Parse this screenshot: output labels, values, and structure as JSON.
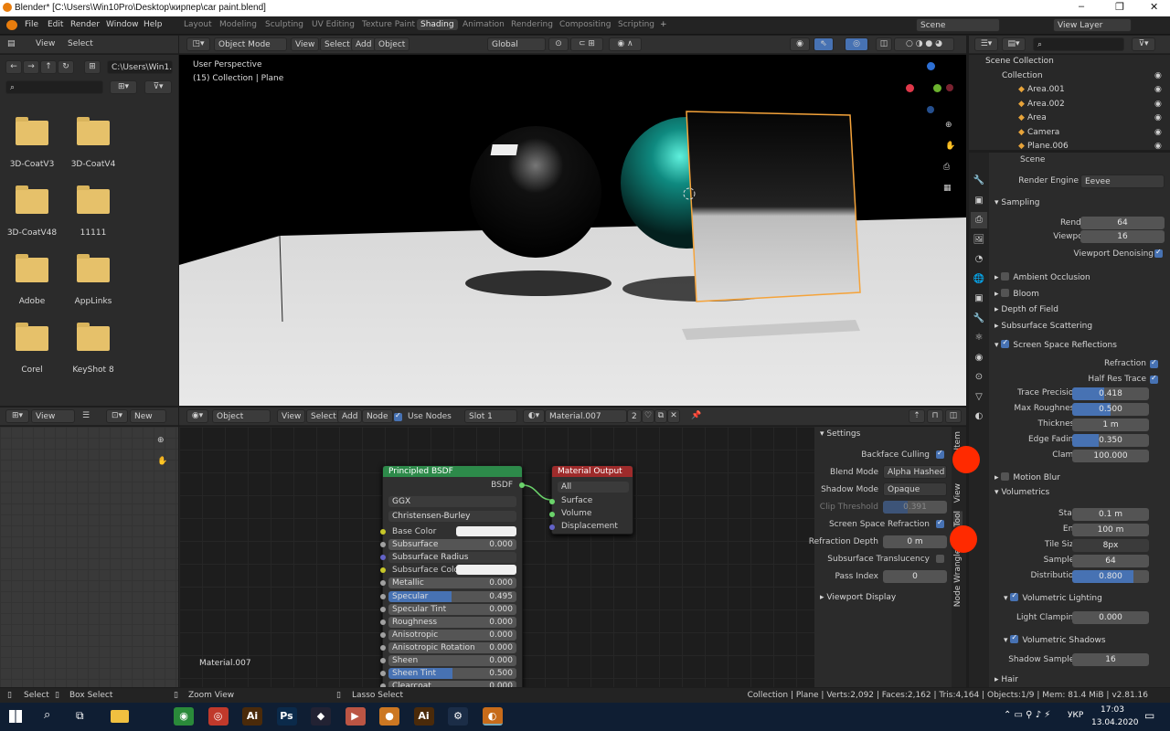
{
  "window": {
    "title": "Blender* [C:\\Users\\Win10Pro\\Desktop\\кирпер\\car paint.blend]",
    "controls": [
      "–",
      "❐",
      "✕"
    ]
  },
  "menu": [
    "File",
    "Edit",
    "Render",
    "Window",
    "Help"
  ],
  "workspaces": [
    "Layout",
    "Modeling",
    "Sculpting",
    "UV Editing",
    "Texture Paint",
    "Shading",
    "Animation",
    "Rendering",
    "Compositing",
    "Scripting"
  ],
  "scene": "Scene",
  "view_layer": "View Layer",
  "filebrowser": {
    "menus": [
      "View",
      "Select"
    ],
    "path": "C:\\Users\\Win1...",
    "folders": [
      "3D-CoatV3",
      "3D-CoatV4",
      "3D-CoatV48",
      "11111",
      "Adobe",
      "AppLinks",
      "Corel",
      "KeyShot 8"
    ]
  },
  "viewport": {
    "mode": "Object Mode",
    "menus": [
      "View",
      "Select",
      "Add",
      "Object"
    ],
    "orient": "Global",
    "persp": "User Perspective",
    "collection": "(15) Collection | Plane"
  },
  "outliner": {
    "items": [
      "Scene Collection",
      "Collection",
      "Area.001",
      "Area.002",
      "Area",
      "Camera",
      "Plane.006"
    ]
  },
  "props": {
    "scene_label": "Scene",
    "engine_label": "Render Engine",
    "engine": "Eevee",
    "sampling": "Sampling",
    "render_label": "Render",
    "render": "64",
    "viewport_label": "Viewport",
    "viewport": "16",
    "denoise": "Viewport Denoising",
    "sections": [
      "Ambient Occlusion",
      "Bloom",
      "Depth of Field",
      "Subsurface Scattering",
      "Screen Space Reflections"
    ],
    "ssr": [
      {
        "l": "Refraction"
      },
      {
        "l": "Half Res Trace"
      }
    ],
    "ssr_fields": [
      {
        "l": "Trace Precision",
        "v": "0.418",
        "f": 0.418
      },
      {
        "l": "Max Roughness",
        "v": "0.500",
        "f": 0.5
      },
      {
        "l": "Thickness",
        "v": "1 m",
        "f": 0
      },
      {
        "l": "Edge Fading",
        "v": "0.350",
        "f": 0.35
      },
      {
        "l": "Clamp",
        "v": "100.000",
        "f": 0
      }
    ],
    "motion_blur": "Motion Blur",
    "volumetrics": "Volumetrics",
    "vol_fields": [
      {
        "l": "Start",
        "v": "0.1 m"
      },
      {
        "l": "End",
        "v": "100 m"
      },
      {
        "l": "Tile Size",
        "v": "8px"
      },
      {
        "l": "Samples",
        "v": "64"
      },
      {
        "l": "Distribution",
        "v": "0.800"
      }
    ],
    "vol_light": "Volumetric Lighting",
    "light_clamp_label": "Light Clamping",
    "light_clamp": "0.000",
    "vol_shadows": "Volumetric Shadows",
    "shadow_samples_label": "Shadow Samples",
    "shadow_samples": "16",
    "hair": "Hair"
  },
  "node_editor": {
    "view": "View",
    "new": "New",
    "object": "Object",
    "menus": [
      "View",
      "Select",
      "Add",
      "Node"
    ],
    "use_nodes": "Use Nodes",
    "slot": "Slot 1",
    "material": "Material.007",
    "users": "2",
    "mat_label": "Material.007"
  },
  "bsdf": {
    "title": "Principled BSDF",
    "out": "BSDF",
    "dist": "GGX",
    "sss": "Christensen-Burley",
    "rows": [
      {
        "l": "Base Color",
        "t": "color"
      },
      {
        "l": "Subsurface",
        "v": "0.000"
      },
      {
        "l": "Subsurface Radius",
        "t": "vec"
      },
      {
        "l": "Subsurface Color",
        "t": "color"
      },
      {
        "l": "Metallic",
        "v": "0.000"
      },
      {
        "l": "Specular",
        "v": "0.495",
        "f": 0.495
      },
      {
        "l": "Specular Tint",
        "v": "0.000"
      },
      {
        "l": "Roughness",
        "v": "0.000"
      },
      {
        "l": "Anisotropic",
        "v": "0.000"
      },
      {
        "l": "Anisotropic Rotation",
        "v": "0.000"
      },
      {
        "l": "Sheen",
        "v": "0.000"
      },
      {
        "l": "Sheen Tint",
        "v": "0.500",
        "f": 0.5
      },
      {
        "l": "Clearcoat",
        "v": "0.000"
      }
    ]
  },
  "matout": {
    "title": "Material Output",
    "target": "All",
    "inputs": [
      "Surface",
      "Volume",
      "Displacement"
    ]
  },
  "settings": {
    "title": "Settings",
    "backface": "Backface Culling",
    "blend_label": "Blend Mode",
    "blend": "Alpha Hashed",
    "shadow_label": "Shadow Mode",
    "shadow": "Opaque",
    "clip_label": "Clip Threshold",
    "clip": "0.391",
    "ssr": "Screen Space Refraction",
    "refr_label": "Refraction Depth",
    "refr": "0 m",
    "sst": "Subsurface Translucency",
    "pass_label": "Pass Index",
    "pass": "0",
    "vd": "Viewport Display"
  },
  "side_tabs": [
    "Item",
    "View",
    "Tool",
    "Node Wrangler"
  ],
  "status": {
    "select": "Select",
    "box": "Box Select",
    "zoom": "Zoom View",
    "lasso": "Lasso Select",
    "stats": "Collection | Plane | Verts:2,092 | Faces:2,162 | Tris:4,164 | Objects:1/9 | Mem: 81.4 MiB | v2.81.16"
  },
  "taskbar": {
    "lang": "УКР",
    "time": "17:03",
    "date": "13.04.2020",
    "apps": [
      {
        "g": "◉",
        "c": "#2a8a3a"
      },
      {
        "g": "◎",
        "c": "#c0392b"
      },
      {
        "g": "Ai",
        "c": "#4a2a0a"
      },
      {
        "g": "Ps",
        "c": "#0b2a4a"
      },
      {
        "g": "◆",
        "c": "#223"
      },
      {
        "g": "▶",
        "c": "#b54"
      },
      {
        "g": "●",
        "c": "#c72"
      },
      {
        "g": "Ai",
        "c": "#4a2a0a"
      },
      {
        "g": "⚙",
        "c": "#1b2d47"
      },
      {
        "g": "◐",
        "c": "#c76b1a"
      }
    ]
  }
}
